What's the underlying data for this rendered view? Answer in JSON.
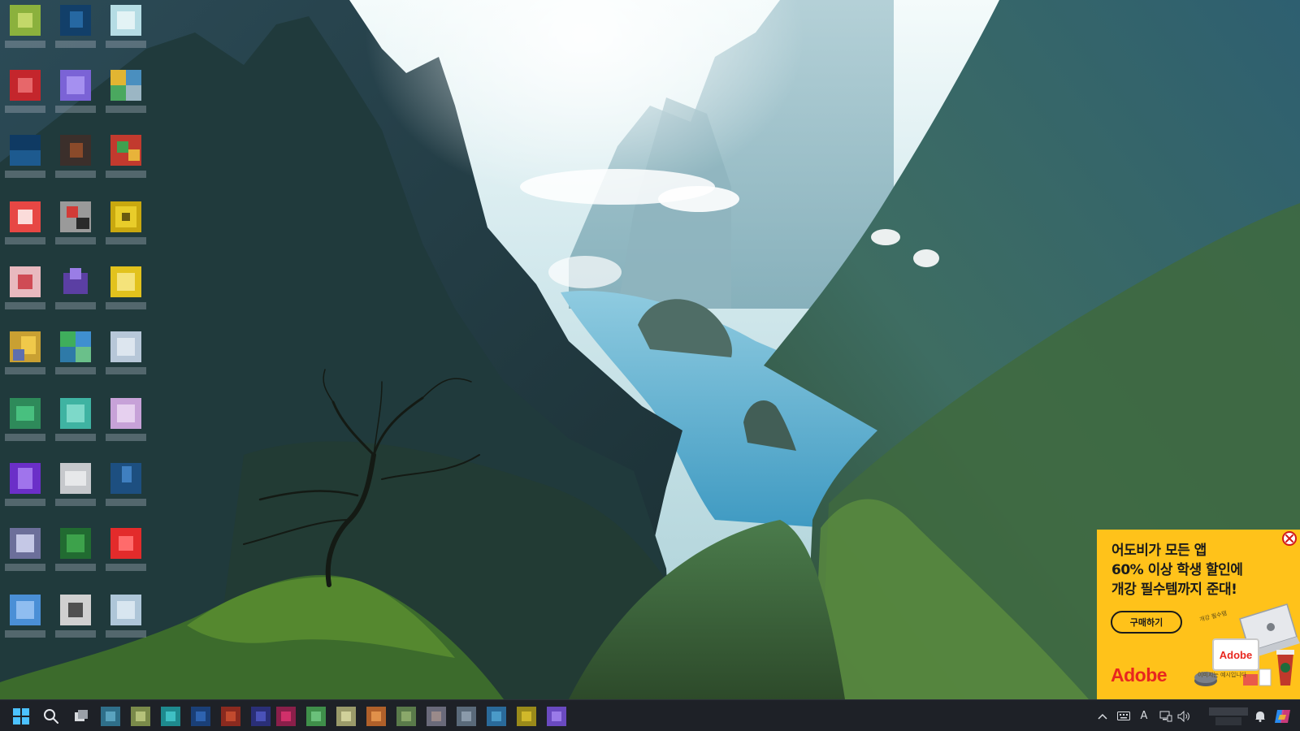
{
  "desktop": {
    "icon_count": 30,
    "note": ""
  },
  "ad": {
    "headline_lines": [
      "어도비가 모든 앱",
      "60% 이상 학생 할인에",
      "개강 필수템까지 준대!"
    ],
    "buy_button": "구매하기",
    "brand": "Adobe",
    "art_brand": "Adobe",
    "art_note": "이미지는 예시입니다",
    "art_hand": "개강 필수템",
    "colors": {
      "background": "#ffc21a",
      "brand_red": "#e8271f"
    }
  },
  "taskbar": {
    "start_icon": "windows-logo-icon",
    "search_icon": "search-icon",
    "task_view_icon": "task-view-icon",
    "tray": {
      "overflow_icon": "chevron-up-icon",
      "keyboard_icon": "keyboard-icon",
      "ime_indicator": "A",
      "network_icon": "network-icon",
      "volume_icon": "speaker-icon",
      "notification_icon": "bell-icon",
      "copilot_icon": "copilot-icon"
    }
  }
}
